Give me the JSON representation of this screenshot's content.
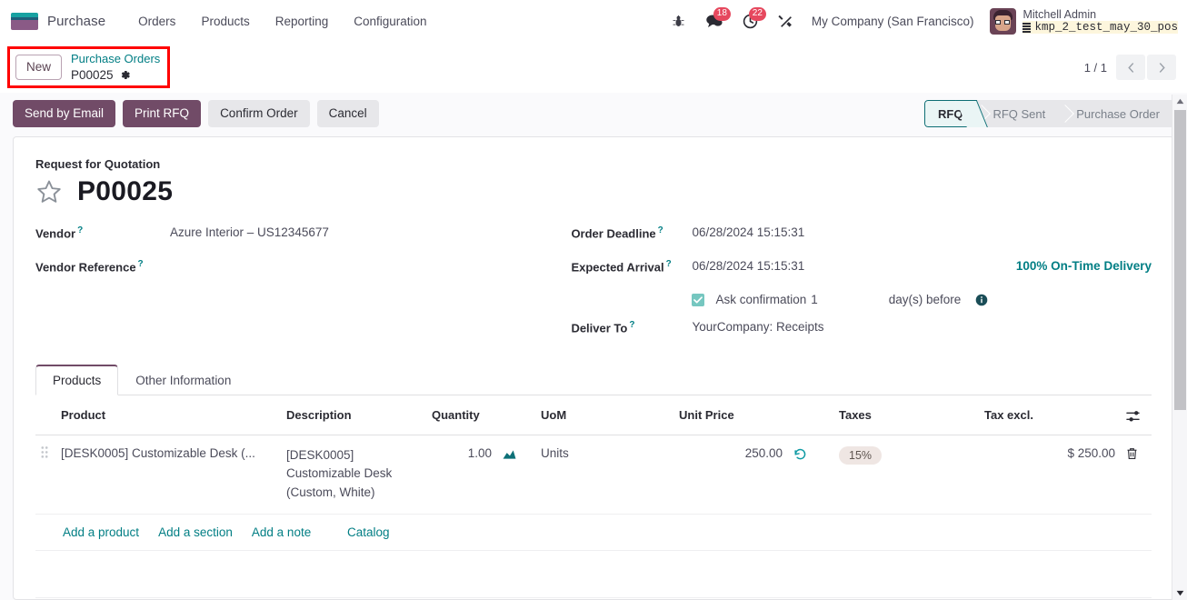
{
  "navbar": {
    "brand": "Purchase",
    "menu": [
      "Orders",
      "Products",
      "Reporting",
      "Configuration"
    ],
    "bug_icon": "bug-icon",
    "messages_icon": "messages-icon",
    "messages_count": "18",
    "activities_icon": "clock-activities-icon",
    "activities_count": "22",
    "tools_icon": "wrench-tools-icon",
    "company": "My Company (San Francisco)",
    "user_name": "Mitchell Admin",
    "user_database": "kmp_2_test_may_30_pos",
    "db_icon": "database-icon"
  },
  "breadcrumb": {
    "new_label": "New",
    "parent": "Purchase Orders",
    "current": "P00025",
    "gear_icon": "gear-icon"
  },
  "pager": {
    "count": "1 / 1",
    "prev_icon": "chevron-left-icon",
    "next_icon": "chevron-right-icon"
  },
  "actions": {
    "send_by_email": "Send by Email",
    "print_rfq": "Print RFQ",
    "confirm_order": "Confirm Order",
    "cancel": "Cancel"
  },
  "statusbar": {
    "stages": [
      "RFQ",
      "RFQ Sent",
      "Purchase Order"
    ],
    "active_index": 0
  },
  "form": {
    "subtitle": "Request for Quotation",
    "title": "P00025",
    "star_icon": "star-favorite-icon",
    "left_fields": [
      {
        "label": "Vendor",
        "help": "?",
        "value": "Azure Interior – US12345677"
      },
      {
        "label": "Vendor Reference",
        "help": "?",
        "value": ""
      }
    ],
    "right_fields": [
      {
        "label": "Order Deadline",
        "help": "?",
        "value": "06/28/2024 15:15:31"
      },
      {
        "label": "Expected Arrival",
        "help": "?",
        "value": "06/28/2024 15:15:31"
      },
      {
        "label": "Deliver To",
        "help": "?",
        "value": "YourCompany: Receipts"
      }
    ],
    "on_time_delivery": "100% On-Time Delivery",
    "ask_confirmation": {
      "label": "Ask confirmation",
      "days": "1",
      "suffix": "day(s) before",
      "checkbox_icon": "checkbox-checked-icon",
      "info_icon": "info-circle-icon"
    }
  },
  "notebook": {
    "tabs": [
      "Products",
      "Other Information"
    ],
    "active_tab": 0
  },
  "lines_table": {
    "columns": [
      "Product",
      "Description",
      "Quantity",
      "UoM",
      "Unit Price",
      "Taxes",
      "Tax excl."
    ],
    "optional_columns_icon": "column-settings-icon",
    "rows": [
      {
        "drag_icon": "drag-handle-icon",
        "product": "[DESK0005] Customizable Desk (...",
        "description": "[DESK0005]\nCustomizable Desk\n(Custom, White)",
        "description_lines": [
          "[DESK0005]",
          "Customizable Desk",
          "(Custom, White)"
        ],
        "quantity": "1.00",
        "forecast_icon": "forecast-chart-icon",
        "uom": "Units",
        "unit_price": "250.00",
        "history_icon": "price-history-icon",
        "taxes": "15%",
        "tax_excl": "$ 250.00",
        "delete_icon": "trash-delete-icon"
      }
    ],
    "footer_links": [
      "Add a product",
      "Add a section",
      "Add a note",
      "Catalog"
    ]
  },
  "scrollbar": {
    "up_icon": "scroll-up-arrow",
    "down_icon": "scroll-down-arrow"
  }
}
